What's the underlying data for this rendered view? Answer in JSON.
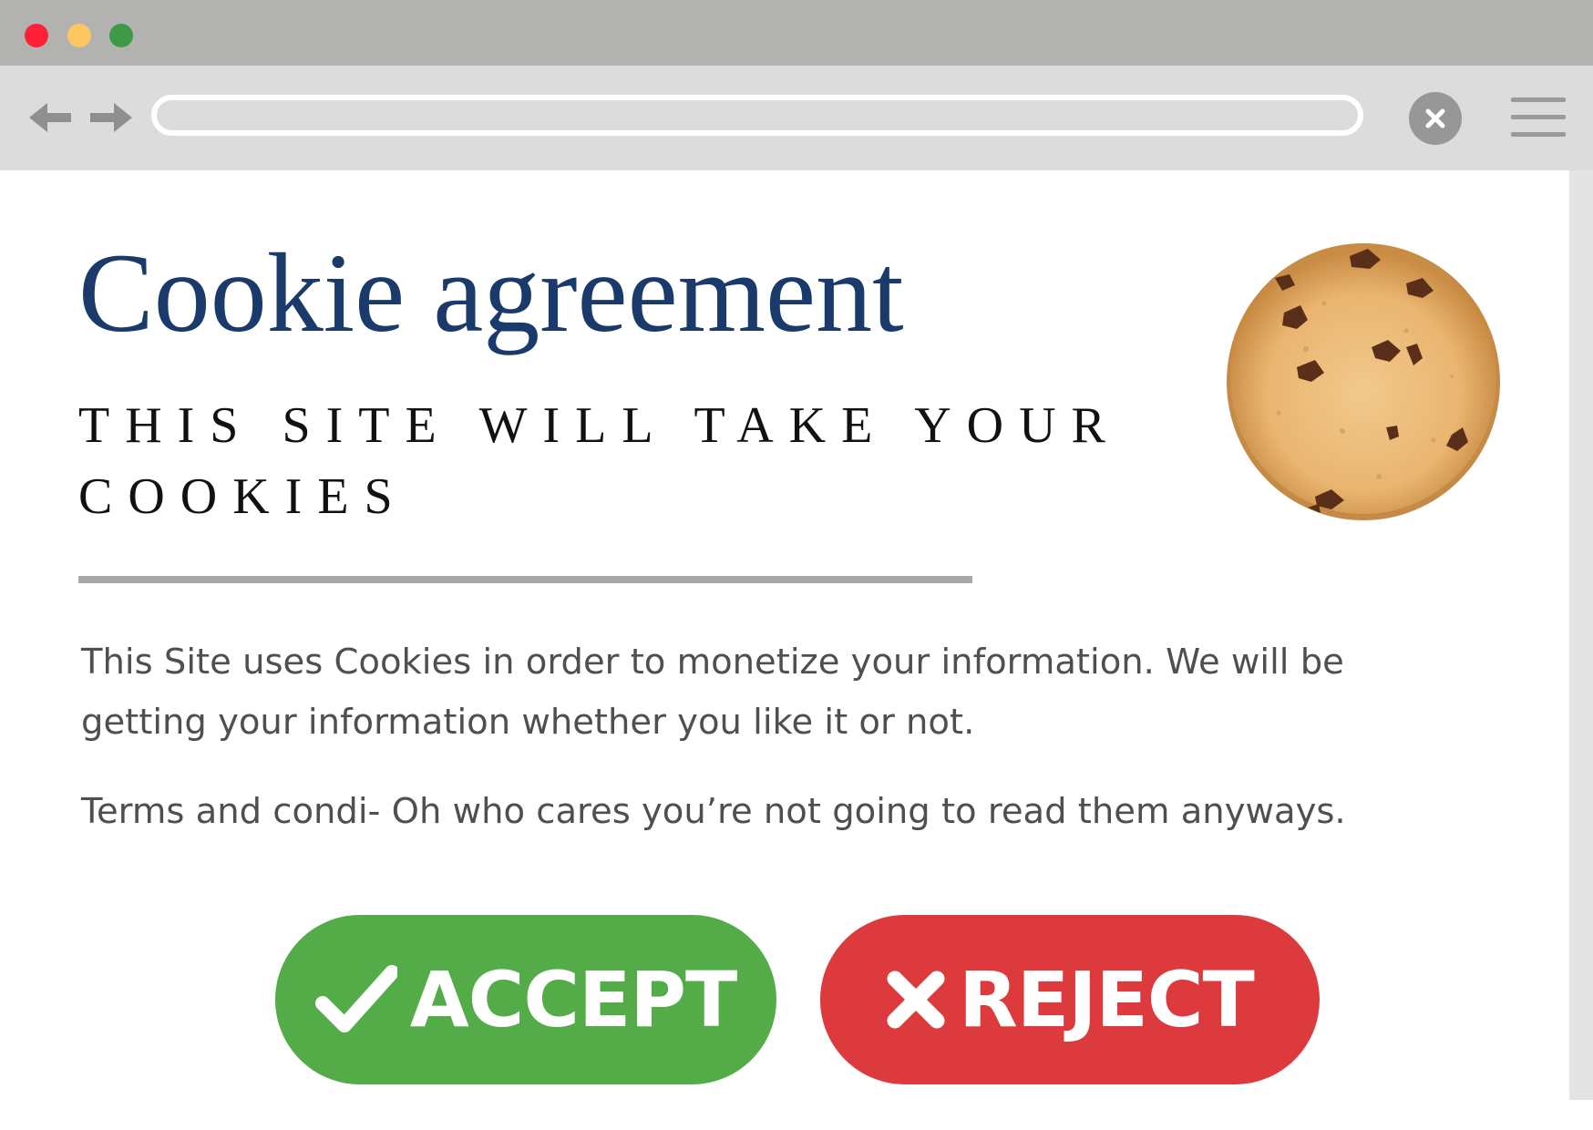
{
  "window": {
    "controls": [
      {
        "name": "close",
        "color": "#ff1f36"
      },
      {
        "name": "minimize",
        "color": "#fdc662"
      },
      {
        "name": "maximize",
        "color": "#3e9a47"
      }
    ]
  },
  "toolbar": {
    "back_icon": "arrow-left-icon",
    "forward_icon": "arrow-right-icon",
    "url": "",
    "close_icon": "close-icon",
    "menu_icon": "hamburger-menu-icon"
  },
  "dialog": {
    "title": "Cookie agreement",
    "subtitle": "THIS SITE WILL TAKE YOUR COOKIES",
    "paragraph_1": "This Site uses Cookies in order to monetize your information. We will be getting your information whether you like it or not.",
    "paragraph_2": "Terms and condi- Oh who cares you’re not going to read them anyways.",
    "illustration": "chocolate-chip-cookie-icon"
  },
  "buttons": {
    "accept": {
      "label": "ACCEPT",
      "icon": "checkmark-icon",
      "color": "#53ac47"
    },
    "reject": {
      "label": "REJECT",
      "icon": "x-icon",
      "color": "#dc3a3c"
    }
  },
  "colors": {
    "title": "#1a3a6b",
    "titlebar": "#b2b2b0",
    "toolbar": "#dcdcdd",
    "body_text": "#4f4f4f"
  }
}
